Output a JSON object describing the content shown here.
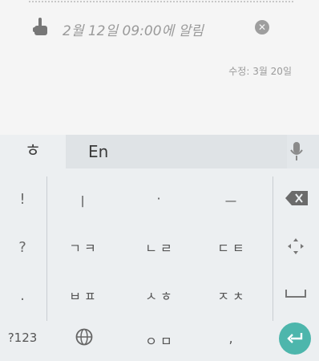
{
  "note": {
    "reminder_text": "2월 12일 09:00에 알림",
    "modified_text": "수정: 3월 20일"
  },
  "keyboard": {
    "hangul_key": "ㅎ",
    "language_label": "En",
    "left_keys": [
      "!",
      "?",
      "."
    ],
    "rows": [
      [
        "ㅣ",
        "·",
        "ㅡ"
      ],
      [
        "ㄱㅋ",
        "ㄴㄹ",
        "ㄷㅌ"
      ],
      [
        "ㅂㅍ",
        "ㅅㅎ",
        "ㅈㅊ"
      ]
    ],
    "bottom": {
      "num_key": "?123",
      "center_key": "ㅇㅁ",
      "comma_key": ","
    }
  },
  "colors": {
    "accent": "#4db6ac",
    "keyboard_bg": "#eceff1",
    "text_muted": "#9a9a9a"
  },
  "icons": [
    "pointing-hand-icon",
    "close-icon",
    "microphone-icon",
    "backspace-icon",
    "cursor-move-icon",
    "space-icon",
    "globe-icon",
    "enter-icon"
  ]
}
